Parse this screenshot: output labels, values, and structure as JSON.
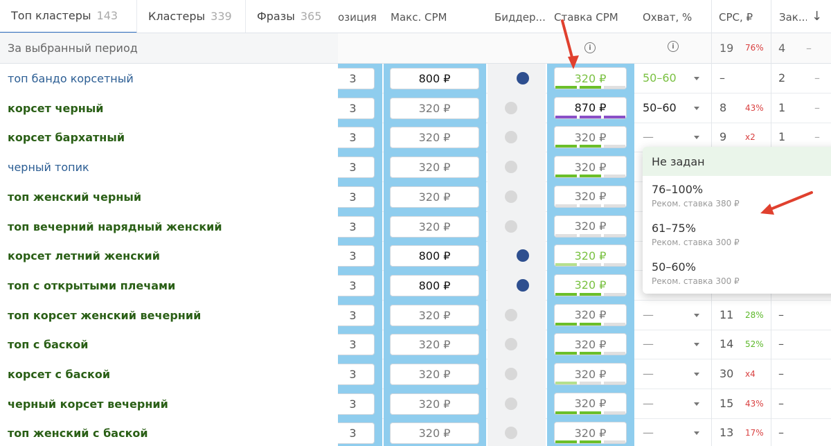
{
  "tabs": [
    {
      "label": "Топ кластеры",
      "count": "143"
    },
    {
      "label": "Кластеры",
      "count": "339"
    },
    {
      "label": "Фразы",
      "count": "365"
    }
  ],
  "columns": {
    "position": "озиция",
    "max_cpm": "Макс. CPM",
    "bidder": "Биддер...",
    "bid_cpm": "Ставка CPM",
    "coverage": "Охват, %",
    "cpc": "CPC, ₽",
    "orders": "Зак..."
  },
  "summary": {
    "label": "За выбранный период",
    "cpc": "19",
    "cpc_pct": "76%",
    "orders": "4",
    "orders_extra": "–"
  },
  "rows": [
    {
      "name": "топ бандо корсетный",
      "style": "blue",
      "position": "3",
      "max_cpm": "800 ₽",
      "bidder": true,
      "bid": "320 ₽",
      "bid_active": true,
      "bars": [
        "#6bbf2a",
        "#6bbf2a",
        "#e0e0e0"
      ],
      "coverage": "50–60",
      "coverage_green": true,
      "cpc": "–",
      "pct": "",
      "pct_color": "",
      "orders": "2",
      "orders_extra": "–"
    },
    {
      "name": "корсет черный",
      "style": "green",
      "position": "3",
      "max_cpm": "320 ₽",
      "bidder": false,
      "bid": "870 ₽",
      "bid_active": false,
      "bid_dark": true,
      "bars": [
        "#8a4fc7",
        "#8a4fc7",
        "#8a4fc7"
      ],
      "coverage": "50–60",
      "coverage_green": false,
      "cpc": "8",
      "pct": "43%",
      "pct_color": "#d94040",
      "orders": "1",
      "orders_extra": "–"
    },
    {
      "name": "корсет бархатный",
      "style": "green",
      "position": "3",
      "max_cpm": "320 ₽",
      "bidder": false,
      "bid": "320 ₽",
      "bid_active": false,
      "bars": [
        "#6bbf2a",
        "#6bbf2a",
        "#e0e0e0"
      ],
      "coverage": "—",
      "coverage_green": false,
      "cpc": "9",
      "pct": "x2",
      "pct_color": "#d94040",
      "orders": "1",
      "orders_extra": "–"
    },
    {
      "name": "черный топик",
      "style": "blue",
      "position": "3",
      "max_cpm": "320 ₽",
      "bidder": false,
      "bid": "320 ₽",
      "bid_active": false,
      "bars": [
        "#6bbf2a",
        "#6bbf2a",
        "#e0e0e0"
      ],
      "coverage": "",
      "cpc": "",
      "pct": "",
      "orders": "",
      "orders_extra": ""
    },
    {
      "name": "топ женский черный",
      "style": "green",
      "position": "3",
      "max_cpm": "320 ₽",
      "bidder": false,
      "bid": "320 ₽",
      "bid_active": false,
      "bars": [
        "#e0e0e0",
        "#e0e0e0",
        "#e0e0e0"
      ],
      "coverage": "",
      "cpc": "",
      "pct": "",
      "orders": "",
      "orders_extra": ""
    },
    {
      "name": "топ вечерний нарядный женский",
      "style": "green",
      "position": "3",
      "max_cpm": "320 ₽",
      "bidder": false,
      "bid": "320 ₽",
      "bid_active": false,
      "bars": [
        "#e0e0e0",
        "#e0e0e0",
        "#e0e0e0"
      ],
      "coverage": "",
      "cpc": "",
      "pct": "",
      "orders": "",
      "orders_extra": ""
    },
    {
      "name": "корсет летний женский",
      "style": "green",
      "position": "3",
      "max_cpm": "800 ₽",
      "bidder": true,
      "bid": "320 ₽",
      "bid_active": true,
      "bars": [
        "#b6e08e",
        "#e0e0e0",
        "#e0e0e0"
      ],
      "coverage": "",
      "cpc": "",
      "pct": "",
      "orders": "",
      "orders_extra": ""
    },
    {
      "name": "топ с открытыми плечами",
      "style": "green",
      "position": "3",
      "max_cpm": "800 ₽",
      "bidder": true,
      "bid": "320 ₽",
      "bid_active": true,
      "bars": [
        "#6bbf2a",
        "#6bbf2a",
        "#e0e0e0"
      ],
      "coverage": "",
      "cpc": "",
      "pct": "",
      "orders": "",
      "orders_extra": ""
    },
    {
      "name": "топ корсет женский вечерний",
      "style": "green",
      "position": "3",
      "max_cpm": "320 ₽",
      "bidder": false,
      "bid": "320 ₽",
      "bid_active": false,
      "bars": [
        "#6bbf2a",
        "#6bbf2a",
        "#e0e0e0"
      ],
      "coverage": "—",
      "coverage_green": false,
      "cpc": "11",
      "pct": "28%",
      "pct_color": "#5cb82a",
      "orders": "–",
      "orders_extra": ""
    },
    {
      "name": "топ с баской",
      "style": "green",
      "position": "3",
      "max_cpm": "320 ₽",
      "bidder": false,
      "bid": "320 ₽",
      "bid_active": false,
      "bars": [
        "#6bbf2a",
        "#6bbf2a",
        "#e0e0e0"
      ],
      "coverage": "—",
      "coverage_green": false,
      "cpc": "14",
      "pct": "52%",
      "pct_color": "#5cb82a",
      "orders": "–",
      "orders_extra": ""
    },
    {
      "name": "корсет с баской",
      "style": "green",
      "position": "3",
      "max_cpm": "320 ₽",
      "bidder": false,
      "bid": "320 ₽",
      "bid_active": false,
      "bars": [
        "#b6e08e",
        "#e0e0e0",
        "#e0e0e0"
      ],
      "coverage": "—",
      "coverage_green": false,
      "cpc": "30",
      "pct": "x4",
      "pct_color": "#d94040",
      "orders": "–",
      "orders_extra": ""
    },
    {
      "name": "черный корсет вечерний",
      "style": "green",
      "position": "3",
      "max_cpm": "320 ₽",
      "bidder": false,
      "bid": "320 ₽",
      "bid_active": false,
      "bars": [
        "#6bbf2a",
        "#6bbf2a",
        "#e0e0e0"
      ],
      "coverage": "—",
      "coverage_green": false,
      "cpc": "15",
      "pct": "43%",
      "pct_color": "#d94040",
      "orders": "–",
      "orders_extra": ""
    },
    {
      "name": "топ женский с баской",
      "style": "green",
      "position": "3",
      "max_cpm": "320 ₽",
      "bidder": false,
      "bid": "320 ₽",
      "bid_active": false,
      "bars": [
        "#6bbf2a",
        "#6bbf2a",
        "#e0e0e0"
      ],
      "coverage": "—",
      "coverage_green": false,
      "cpc": "13",
      "pct": "17%",
      "pct_color": "#d94040",
      "orders": "–",
      "orders_extra": ""
    }
  ],
  "dropdown": {
    "first": "Не задан",
    "options": [
      {
        "label": "76–100%",
        "sub": "Реком. ставка 380 ₽"
      },
      {
        "label": "61–75%",
        "sub": "Реком. ставка 300 ₽"
      },
      {
        "label": "50–60%",
        "sub": "Реком. ставка 300 ₽"
      }
    ]
  }
}
